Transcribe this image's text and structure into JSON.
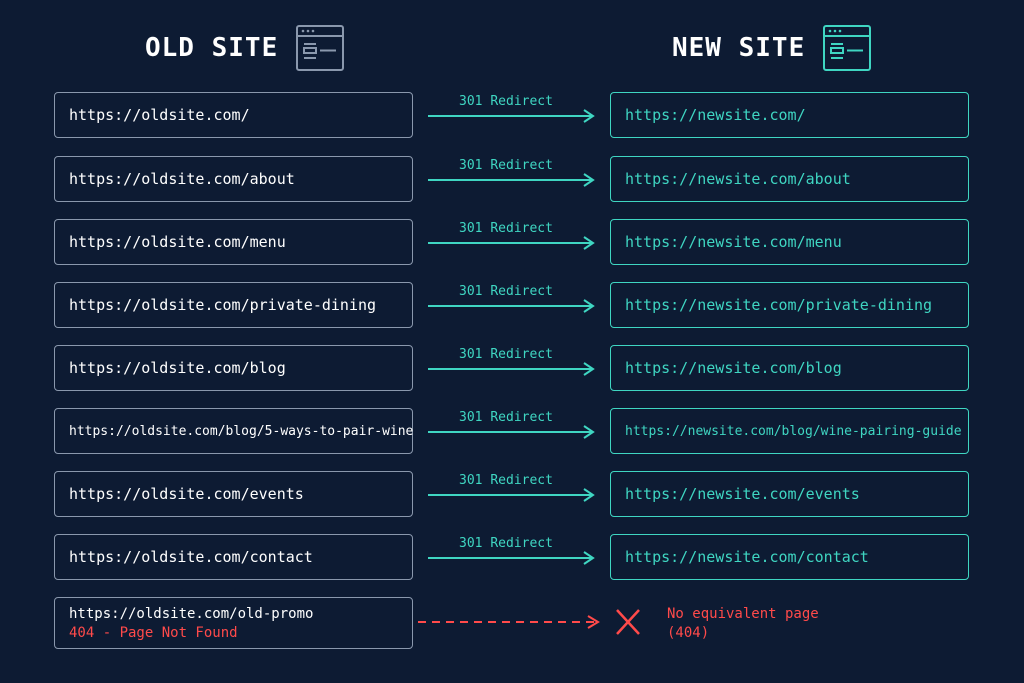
{
  "headers": {
    "old_title": "OLD SITE",
    "new_title": "NEW SITE",
    "old_icon": "browser-window-icon",
    "new_icon": "browser-window-icon"
  },
  "colors": {
    "background": "#0d1b33",
    "accent": "#3fd6c2",
    "error": "#ff4a4a",
    "neutral_border": "#8a98ad"
  },
  "redirects": [
    {
      "old": "https://oldsite.com/",
      "label": "301 Redirect",
      "new": "https://newsite.com/"
    },
    {
      "old": "https://oldsite.com/about",
      "label": "301 Redirect",
      "new": "https://newsite.com/about"
    },
    {
      "old": "https://oldsite.com/menu",
      "label": "301 Redirect",
      "new": "https://newsite.com/menu"
    },
    {
      "old": "https://oldsite.com/private-dining",
      "label": "301 Redirect",
      "new": "https://newsite.com/private-dining"
    },
    {
      "old": "https://oldsite.com/blog",
      "label": "301 Redirect",
      "new": "https://newsite.com/blog"
    },
    {
      "old": "https://oldsite.com/blog/5-ways-to-pair-wine",
      "label": "301 Redirect",
      "new": "https://newsite.com/blog/wine-pairing-guide"
    },
    {
      "old": "https://oldsite.com/events",
      "label": "301 Redirect",
      "new": "https://newsite.com/events"
    },
    {
      "old": "https://oldsite.com/contact",
      "label": "301 Redirect",
      "new": "https://newsite.com/contact"
    }
  ],
  "not_found": {
    "old": "https://oldsite.com/old-promo",
    "status": "404 - Page Not Found",
    "result_line1": "No equivalent page",
    "result_line2": "(404)",
    "icon": "x-icon"
  }
}
